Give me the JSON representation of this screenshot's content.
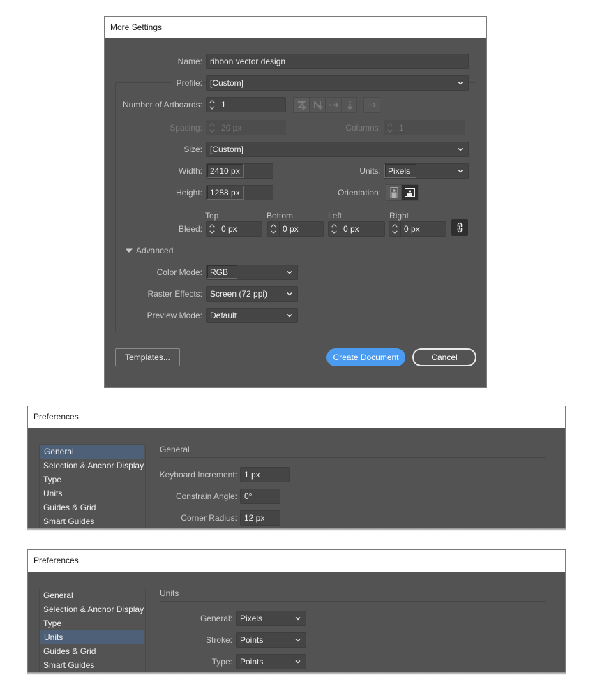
{
  "more_settings": {
    "title": "More Settings",
    "name_label": "Name:",
    "name_value": "ribbon vector design",
    "profile_label": "Profile:",
    "profile_value": "[Custom]",
    "artboards_label": "Number of Artboards:",
    "artboards_value": "1",
    "artboard_layout_icons": [
      "grid-by-row-icon",
      "grid-by-column-icon",
      "arrange-by-row-icon",
      "arrange-by-column-icon",
      "right-to-left-icon"
    ],
    "spacing_label": "Spacing:",
    "spacing_value": "20 px",
    "columns_label": "Columns:",
    "columns_value": "1",
    "size_label": "Size:",
    "size_value": "[Custom]",
    "width_label": "Width:",
    "width_value": "2410 px",
    "height_label": "Height:",
    "height_value": "1288 px",
    "units_label": "Units:",
    "units_value": "Pixels",
    "orientation_label": "Orientation:",
    "orientation_selected": "landscape",
    "bleed_label": "Bleed:",
    "bleed": [
      {
        "label": "Top",
        "value": "0 px"
      },
      {
        "label": "Bottom",
        "value": "0 px"
      },
      {
        "label": "Left",
        "value": "0 px"
      },
      {
        "label": "Right",
        "value": "0 px"
      }
    ],
    "advanced_label": "Advanced",
    "color_mode_label": "Color Mode:",
    "color_mode_value": "RGB",
    "raster_label": "Raster Effects:",
    "raster_value": "Screen (72 ppi)",
    "preview_label": "Preview Mode:",
    "preview_value": "Default",
    "templates_button": "Templates...",
    "create_button": "Create Document",
    "cancel_button": "Cancel",
    "accent_color": "#4b9cf0"
  },
  "preferences_general": {
    "title": "Preferences",
    "sidebar": [
      "General",
      "Selection & Anchor Display",
      "Type",
      "Units",
      "Guides & Grid",
      "Smart Guides"
    ],
    "selected": "General",
    "section_title": "General",
    "keyboard_increment_label": "Keyboard Increment:",
    "keyboard_increment_value": "1 px",
    "constrain_angle_label": "Constrain Angle:",
    "constrain_angle_value": "0°",
    "corner_radius_label": "Corner Radius:",
    "corner_radius_value": "12 px"
  },
  "preferences_units": {
    "title": "Preferences",
    "sidebar": [
      "General",
      "Selection & Anchor Display",
      "Type",
      "Units",
      "Guides & Grid",
      "Smart Guides"
    ],
    "selected": "Units",
    "section_title": "Units",
    "general_label": "General:",
    "general_value": "Pixels",
    "stroke_label": "Stroke:",
    "stroke_value": "Points",
    "type_label": "Type:",
    "type_value": "Points",
    "selection_color": "#4e6078"
  }
}
